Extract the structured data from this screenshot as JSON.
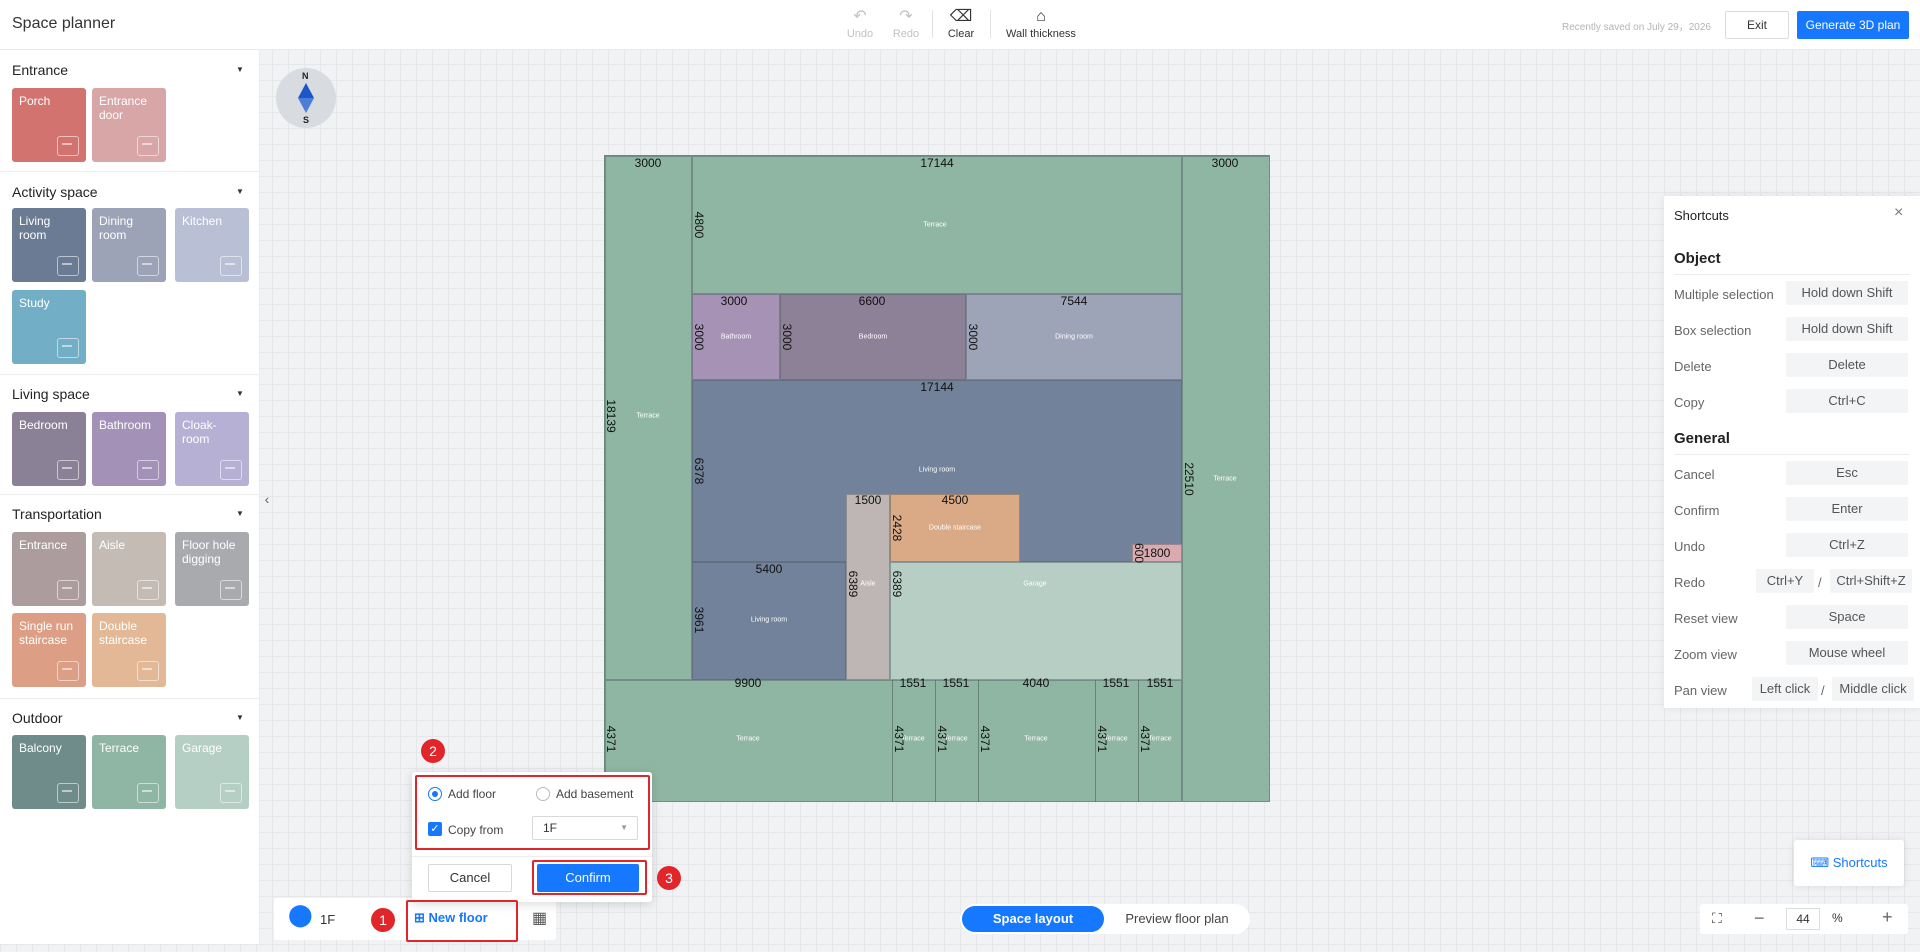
{
  "app": {
    "title": "Space planner"
  },
  "toolbar": {
    "undo": "Undo",
    "redo": "Redo",
    "clear": "Clear",
    "wall_thickness": "Wall thickness",
    "saved_text": "Recently saved on July 29，2026",
    "exit": "Exit",
    "generate": "Generate 3D plan"
  },
  "sidebar": {
    "categories": [
      {
        "title": "Entrance",
        "items": [
          {
            "label": "Porch",
            "color": "#d2736f",
            "icon": "door-icon"
          },
          {
            "label": "Entrance door",
            "color": "#d8a6a6",
            "icon": "keypad-door-icon"
          }
        ]
      },
      {
        "title": "Activity space",
        "items": [
          {
            "label": "Living room",
            "color": "#6a7b93",
            "icon": "sofa-icon"
          },
          {
            "label": "Dining room",
            "color": "#9da3b6",
            "icon": "cutlery-icon"
          },
          {
            "label": "Kitchen",
            "color": "#b9c0d6",
            "icon": "range-hood-icon"
          },
          {
            "label": "Study",
            "color": "#72aec5",
            "icon": "desk-lamp-icon"
          }
        ]
      },
      {
        "title": "Living space",
        "items": [
          {
            "label": "Bedroom",
            "color": "#8a8196",
            "icon": "bed-icon"
          },
          {
            "label": "Bathroom",
            "color": "#a391b7",
            "icon": "toilet-icon"
          },
          {
            "label": "Cloak-room",
            "color": "#b6b0d4",
            "icon": "wardrobe-icon"
          }
        ]
      },
      {
        "title": "Transportation",
        "items": [
          {
            "label": "Entrance",
            "color": "#ad9c9d",
            "icon": "building-entrance-icon"
          },
          {
            "label": "Aisle",
            "color": "#c5bbb5",
            "icon": "path-icon"
          },
          {
            "label": "Floor hole digging",
            "color": "#a9aaad",
            "icon": "hole-icon"
          },
          {
            "label": "Single run staircase",
            "color": "#dc9e84",
            "icon": "stair-icon"
          },
          {
            "label": "Double staircase",
            "color": "#e3b896",
            "icon": "double-stair-icon"
          }
        ]
      },
      {
        "title": "Outdoor",
        "items": [
          {
            "label": "Balcony",
            "color": "#6f8c8a",
            "icon": "balcony-icon"
          },
          {
            "label": "Terrace",
            "color": "#8fb5a4",
            "icon": "sun-icon"
          },
          {
            "label": "Garage",
            "color": "#b5cfc4",
            "icon": "car-icon"
          }
        ]
      }
    ]
  },
  "compass": {
    "north": "N",
    "south": "S"
  },
  "plan": {
    "room_labels": {
      "terrace": "Terrace",
      "bathroom": "Bathroom",
      "bedroom": "Bedroom",
      "dining": "Dining room",
      "living": "Living room",
      "aisle": "Aisle",
      "stairs": "Double staircase",
      "garage": "Garage"
    },
    "dims": {
      "d3000a": "3000",
      "d17144a": "17144",
      "d3000b": "3000",
      "d4800": "4800",
      "d3000c": "3000",
      "d6600": "6600",
      "d7544": "7544",
      "d3000v1": "3000",
      "d3000v2": "3000",
      "d3000v3": "3000",
      "d18139": "18139",
      "d17144b": "17144",
      "d6378": "6378",
      "d22510": "22510",
      "d1500": "1500",
      "d4500": "4500",
      "d2428": "2428",
      "d600": "600",
      "d1800": "1800",
      "d5400": "5400",
      "d6389a": "6389",
      "d6389b": "6389",
      "d3961": "3961",
      "d9900": "9900",
      "d1551a": "1551",
      "d1551b": "1551",
      "d4040": "4040",
      "d1551c": "1551",
      "d1551d": "1551",
      "d4371a": "4371",
      "d4371b": "4371",
      "d4371c": "4371",
      "d4371d": "4371",
      "d4371e": "4371",
      "d4371f": "4371"
    }
  },
  "shortcuts": {
    "title": "Shortcuts",
    "object_title": "Object",
    "general_title": "General",
    "object": [
      {
        "name": "Multiple selection",
        "key": "Hold down Shift"
      },
      {
        "name": "Box selection",
        "key": "Hold down Shift"
      },
      {
        "name": "Delete",
        "key": "Delete"
      },
      {
        "name": "Copy",
        "key": "Ctrl+C"
      }
    ],
    "general": [
      {
        "name": "Cancel",
        "key": "Esc"
      },
      {
        "name": "Confirm",
        "key": "Enter"
      },
      {
        "name": "Undo",
        "key": "Ctrl+Z"
      },
      {
        "name": "Redo",
        "key": "Ctrl+Y",
        "key2": "Ctrl+Shift+Z"
      },
      {
        "name": "Reset view",
        "key": "Space"
      },
      {
        "name": "Zoom view",
        "key": "Mouse wheel"
      },
      {
        "name": "Pan view",
        "key": "Left click",
        "key2": "Middle click"
      }
    ],
    "float_label": "Shortcuts"
  },
  "floor_bar": {
    "current_floor": "1F",
    "new_floor": "New floor"
  },
  "popup": {
    "add_floor": "Add floor",
    "add_basement": "Add basement",
    "copy_from": "Copy from",
    "copy_from_value": "1F",
    "cancel": "Cancel",
    "confirm": "Confirm",
    "selected_option": "Add floor",
    "copy_from_checked": true
  },
  "steps": [
    "1",
    "2",
    "3"
  ],
  "view_toggle": {
    "active": "Space layout",
    "inactive": "Preview floor plan"
  },
  "zoom": {
    "value": "44",
    "unit": "%"
  },
  "colors": {
    "accent": "#1677ff",
    "highlight": "#e0262b"
  }
}
